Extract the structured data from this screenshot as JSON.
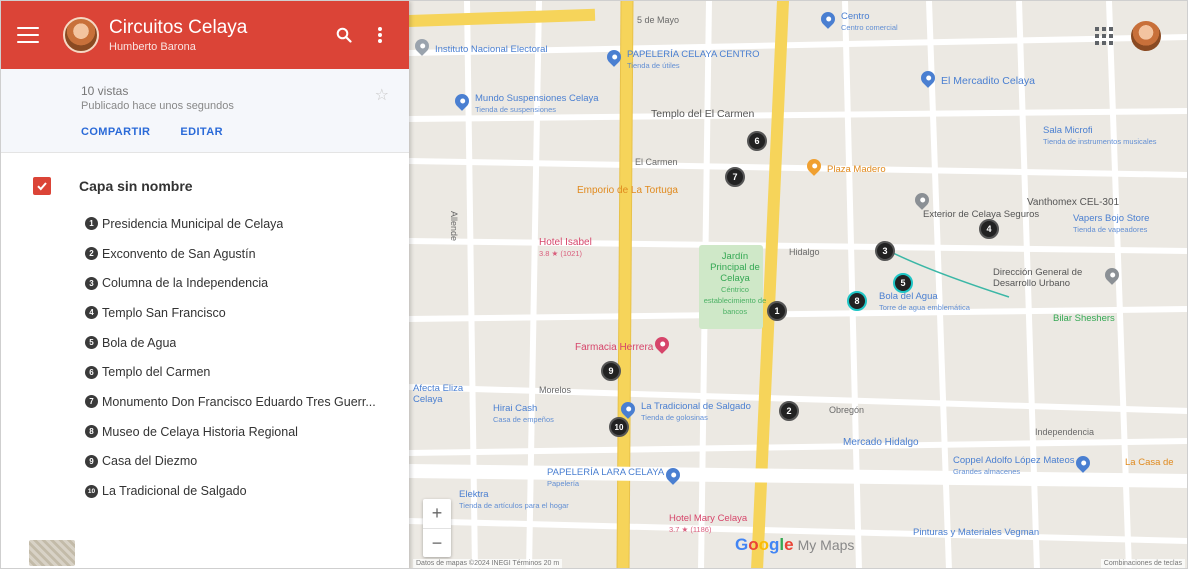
{
  "header": {
    "map_title": "Circuitos Celaya",
    "author": "Humberto Barona"
  },
  "info": {
    "views": "10 vistas",
    "published": "Publicado hace unos segundos",
    "share_label": "COMPARTIR",
    "edit_label": "EDITAR"
  },
  "layer": {
    "name": "Capa sin nombre",
    "items": [
      {
        "num": "1",
        "label": "Presidencia Municipal de Celaya"
      },
      {
        "num": "2",
        "label": "Exconvento de San Agustín"
      },
      {
        "num": "3",
        "label": "Columna de la Independencia"
      },
      {
        "num": "4",
        "label": "Templo San Francisco"
      },
      {
        "num": "5",
        "label": "Bola de Agua"
      },
      {
        "num": "6",
        "label": "Templo del Carmen"
      },
      {
        "num": "7",
        "label": "Monumento Don Francisco Eduardo Tres Guerr..."
      },
      {
        "num": "8",
        "label": "Museo de Celaya Historia Regional"
      },
      {
        "num": "9",
        "label": "Casa del Diezmo"
      },
      {
        "num": "10",
        "label": "La Tradicional de Salgado"
      }
    ]
  },
  "map": {
    "pois": [
      {
        "name": "Instituto Nacional Electoral",
        "sub": "",
        "color": "#4a7fd1"
      },
      {
        "name": "PAPELERÍA CELAYA CENTRO",
        "sub": "Tienda de útiles",
        "color": "#4a7fd1"
      },
      {
        "name": "Mundo Suspensiones Celaya",
        "sub": "Tienda de suspensiones",
        "color": "#4a7fd1"
      },
      {
        "name": "Templo del El Carmen",
        "sub": "",
        "color": "#555555"
      },
      {
        "name": "El Mercadito Celaya",
        "sub": "",
        "color": "#4a7fd1"
      },
      {
        "name": "Centro",
        "sub": "Centro comercial",
        "color": "#4a7fd1"
      },
      {
        "name": "Sala Microfi",
        "sub": "Tienda de instrumentos musicales",
        "color": "#4a7fd1"
      },
      {
        "name": "Emporio de La Tortuga",
        "sub": "",
        "color": "#e08a1e"
      },
      {
        "name": "Plaza Madero",
        "sub": "",
        "color": "#e08a1e"
      },
      {
        "name": "Exterior de Celaya Seguros",
        "sub": "",
        "color": "#555555"
      },
      {
        "name": "Vanthomex CEL-301",
        "sub": "",
        "color": "#555555"
      },
      {
        "name": "Vapers Bojo Store",
        "sub": "Tienda de vapeadores",
        "color": "#4a7fd1"
      },
      {
        "name": "Hotel Isabel",
        "sub": "3.8 ★ (1021)",
        "color": "#d6456a"
      },
      {
        "name": "Jardín Principal de Celaya",
        "sub": "Céntrico establecimiento de bancos",
        "color": "#34a853"
      },
      {
        "name": "Bola del Agua",
        "sub": "Torre de agua emblemática",
        "color": "#4a7fd1"
      },
      {
        "name": "Dirección General de Desarrollo Urbano",
        "sub": "",
        "color": "#555555"
      },
      {
        "name": "Bilar Sheshers",
        "sub": "",
        "color": "#34a853"
      },
      {
        "name": "Farmacia Herrera",
        "sub": "",
        "color": "#d6456a"
      },
      {
        "name": "Afecta Eliza Celaya",
        "sub": "",
        "color": "#4a7fd1"
      },
      {
        "name": "Hirai Cash",
        "sub": "Casa de empeños",
        "color": "#4a7fd1"
      },
      {
        "name": "La Tradicional de Salgado",
        "sub": "Tienda de golosinas",
        "color": "#4a7fd1"
      },
      {
        "name": "Mercado Hidalgo",
        "sub": "",
        "color": "#4a7fd1"
      },
      {
        "name": "Coppel Adolfo López Mateos",
        "sub": "Grandes almacenes",
        "color": "#4a7fd1"
      },
      {
        "name": "La Casa de",
        "sub": "",
        "color": "#e08a1e"
      },
      {
        "name": "PAPELERÍA LARA CELAYA",
        "sub": "Papelería",
        "color": "#4a7fd1"
      },
      {
        "name": "Elektra",
        "sub": "Tienda de artículos para el hogar",
        "color": "#4a7fd1"
      },
      {
        "name": "Hotel Mary Celaya",
        "sub": "3.7 ★ (1186)",
        "color": "#d6456a"
      },
      {
        "name": "Pinturas y Materiales Vegman",
        "sub": "",
        "color": "#4a7fd1"
      }
    ],
    "streets": [
      "5 de Mayo",
      "El Carmen",
      "Hidalgo",
      "Morelos",
      "Allende",
      "Obregón",
      "Independencia"
    ],
    "markers": [
      "1",
      "2",
      "3",
      "4",
      "5",
      "6",
      "7",
      "8",
      "9",
      "10"
    ],
    "brand_google": "Google",
    "brand_mymaps": "My Maps",
    "attribution": "Datos de mapas ©2024 INEGI  Términos  20 m",
    "attribution_right": "Combinaciones de teclas",
    "zoom_in": "+",
    "zoom_out": "−"
  },
  "colors": {
    "header": "#db4437",
    "accent_link": "#2a6ad8",
    "road_major": "#f6d45a",
    "marker": "#222222"
  }
}
